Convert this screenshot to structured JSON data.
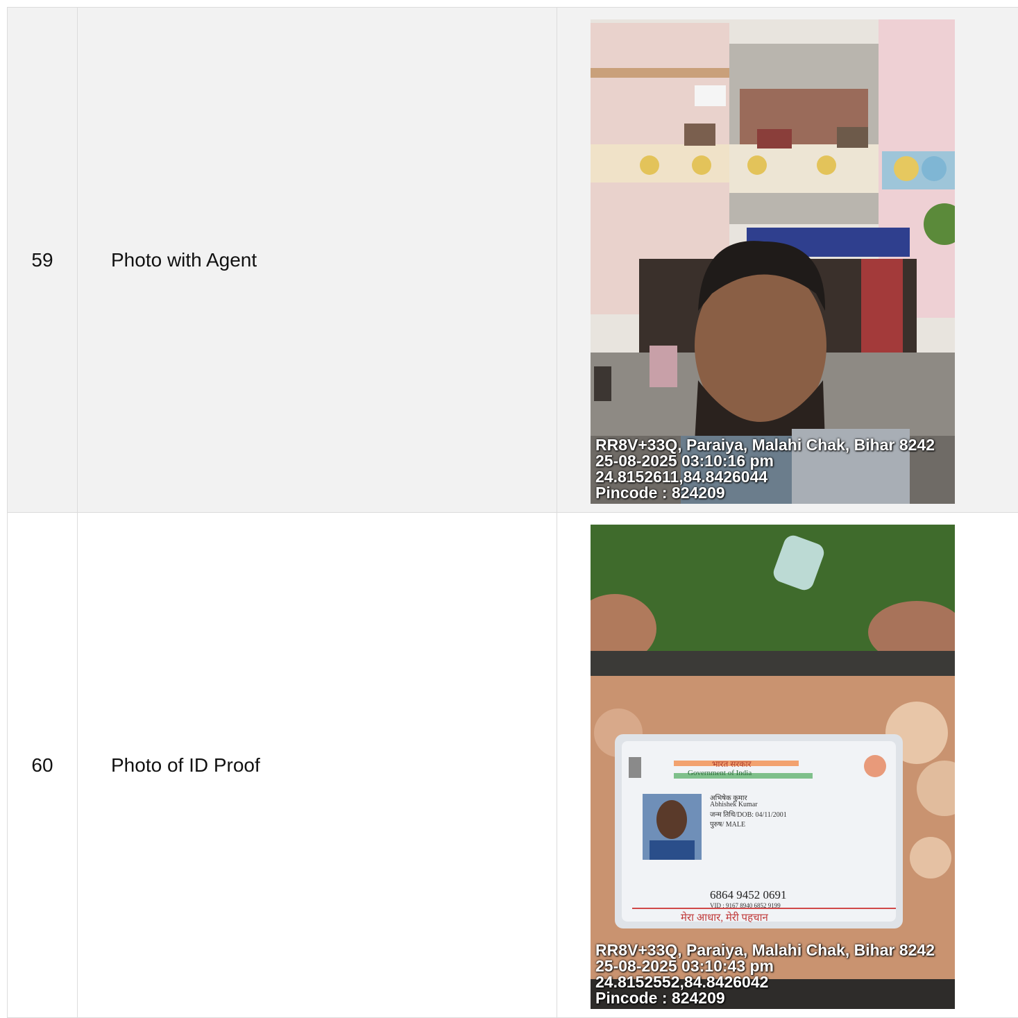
{
  "rows": [
    {
      "number": "59",
      "label": "Photo with Agent",
      "photo": {
        "subject": "selfie of agent in front of shop building",
        "overlay": {
          "address": "RR8V+33Q, Paraiya, Malahi Chak, Bihar 8242",
          "datetime": "25-08-2025 03:10:16 pm",
          "coordinates": "24.8152611,84.8426044",
          "pincode": "Pincode : 824209"
        }
      }
    },
    {
      "number": "60",
      "label": "Photo of ID Proof",
      "photo": {
        "subject": "Aadhaar card held in hand",
        "card": {
          "header_hindi": "भारत सरकार",
          "header_english": "Government of India",
          "name_hindi": "अभिषेक कुमार",
          "name": "Abhishek Kumar",
          "dob": "जन्म तिथि/DOB: 04/11/2001",
          "gender": "पुरुष/ MALE",
          "number": "6864 9452 0691",
          "vid": "VID : 9167 8940 6852 9199",
          "tagline": "मेरा आधार, मेरी पहचान"
        },
        "overlay": {
          "address": "RR8V+33Q, Paraiya, Malahi Chak, Bihar 8242",
          "datetime": "25-08-2025 03:10:43 pm",
          "coordinates": "24.8152552,84.8426042",
          "pincode": "Pincode : 824209"
        }
      }
    }
  ]
}
